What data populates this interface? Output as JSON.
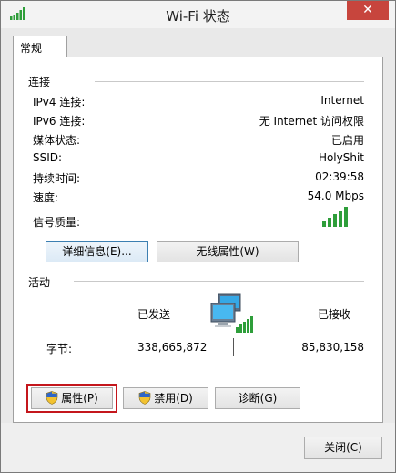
{
  "window": {
    "title": "Wi-Fi 状态",
    "close_glyph": "✕"
  },
  "tabs": [
    {
      "label": "常规"
    }
  ],
  "connection": {
    "heading": "连接",
    "rows": [
      {
        "label": "IPv4 连接:",
        "value": "Internet"
      },
      {
        "label": "IPv6 连接:",
        "value": "无 Internet 访问权限"
      },
      {
        "label": "媒体状态:",
        "value": "已启用"
      },
      {
        "label": "SSID:",
        "value": "HolyShit"
      },
      {
        "label": "持续时间:",
        "value": "02:39:58"
      },
      {
        "label": "速度:",
        "value": "54.0 Mbps"
      }
    ],
    "signal_label": "信号质量:",
    "signal_bars": 5,
    "signal_max": 5
  },
  "connection_buttons": {
    "details": "详细信息(E)...",
    "wireless_props": "无线属性(W)"
  },
  "activity": {
    "heading": "活动",
    "sent_label": "已发送",
    "received_label": "已接收",
    "bytes_label": "字节:",
    "bytes_sent": "338,665,872",
    "bytes_received": "85,830,158"
  },
  "action_buttons": {
    "properties": "属性(P)",
    "disable": "禁用(D)",
    "diagnose": "诊断(G)"
  },
  "footer": {
    "close": "关闭(C)"
  },
  "colors": {
    "signal_green": "#2e9e3a",
    "highlight_red": "#c4161c",
    "close_red": "#c7453d"
  }
}
